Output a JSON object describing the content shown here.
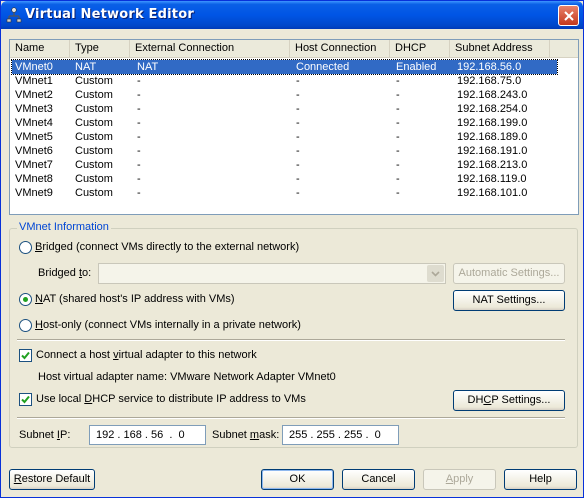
{
  "window": {
    "title": "Virtual Network Editor"
  },
  "table": {
    "columns": [
      "Name",
      "Type",
      "External Connection",
      "Host Connection",
      "DHCP",
      "Subnet Address"
    ],
    "rows": [
      [
        "VMnet0",
        "NAT",
        "NAT",
        "Connected",
        "Enabled",
        "192.168.56.0"
      ],
      [
        "VMnet1",
        "Custom",
        "-",
        "-",
        "-",
        "192.168.75.0"
      ],
      [
        "VMnet2",
        "Custom",
        "-",
        "-",
        "-",
        "192.168.243.0"
      ],
      [
        "VMnet3",
        "Custom",
        "-",
        "-",
        "-",
        "192.168.254.0"
      ],
      [
        "VMnet4",
        "Custom",
        "-",
        "-",
        "-",
        "192.168.199.0"
      ],
      [
        "VMnet5",
        "Custom",
        "-",
        "-",
        "-",
        "192.168.189.0"
      ],
      [
        "VMnet6",
        "Custom",
        "-",
        "-",
        "-",
        "192.168.191.0"
      ],
      [
        "VMnet7",
        "Custom",
        "-",
        "-",
        "-",
        "192.168.213.0"
      ],
      [
        "VMnet8",
        "Custom",
        "-",
        "-",
        "-",
        "192.168.119.0"
      ],
      [
        "VMnet9",
        "Custom",
        "-",
        "-",
        "-",
        "192.168.101.0"
      ]
    ],
    "selected_row": 0
  },
  "info": {
    "group_title": "VMnet Information",
    "bridged": {
      "hotkey": "B",
      "rest": "ridged (connect VMs directly to the external network)",
      "selected": false
    },
    "bridged_to": {
      "pre": "Bridged ",
      "hotkey": "t",
      "post": "o:"
    },
    "automatic_settings": "Automatic Settings...",
    "nat": {
      "hotkey": "N",
      "rest": "AT (shared host's IP address with VMs)",
      "selected": true
    },
    "nat_settings": "NAT Settings...",
    "hostonly": {
      "hotkey": "H",
      "rest": "ost-only (connect VMs internally in a private network)",
      "selected": false
    },
    "connect_adapter": {
      "pre": "Connect a host ",
      "hotkey": "v",
      "post": "irtual adapter to this network",
      "checked": true
    },
    "adapter_name": "Host virtual adapter name: VMware Network Adapter VMnet0",
    "use_dhcp": {
      "pre": "Use local ",
      "hotkey": "D",
      "post": "HCP service to distribute IP address to VMs",
      "checked": true
    },
    "dhcp_settings": {
      "pre": "DH",
      "hotkey": "C",
      "post": "P Settings..."
    },
    "subnet_ip": {
      "pre": "Subnet ",
      "hotkey": "I",
      "post": "P:",
      "value": "192 . 168 . 56  .  0"
    },
    "subnet_mask": {
      "pre": "Subnet ",
      "hotkey": "m",
      "post": "ask:",
      "value": "255 . 255 . 255 .  0"
    }
  },
  "buttons": {
    "restore_default": {
      "hotkey": "R",
      "rest": "estore Default"
    },
    "ok": "OK",
    "cancel": "Cancel",
    "apply": {
      "hotkey": "A",
      "rest": "pply"
    },
    "help": "Help"
  }
}
